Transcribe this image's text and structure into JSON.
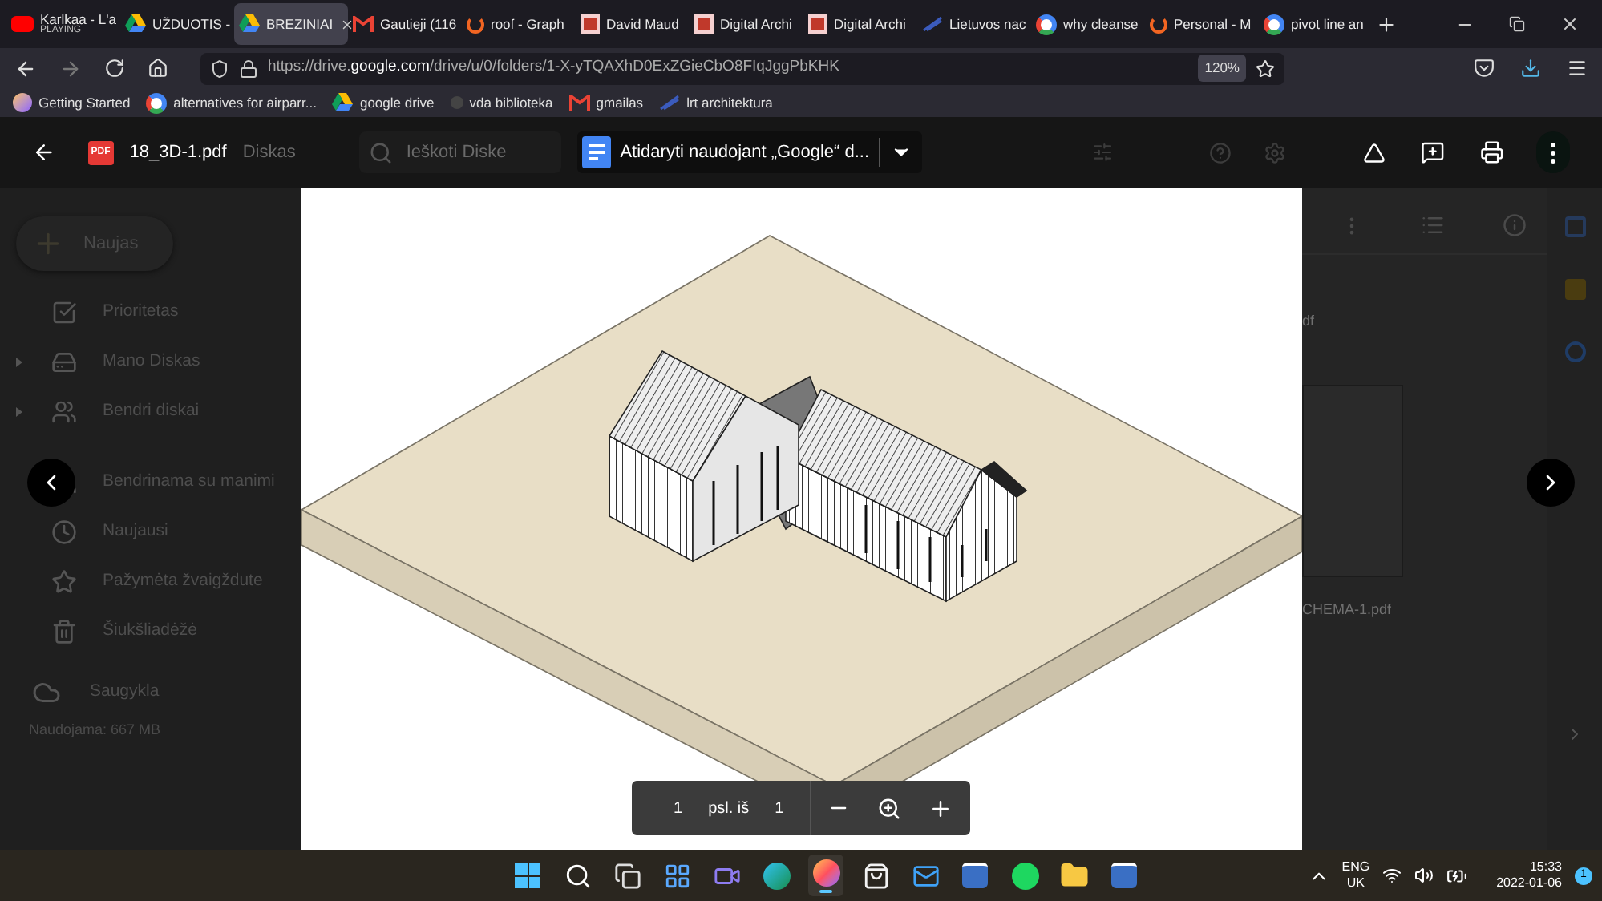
{
  "browser": {
    "tabs": [
      {
        "title": "Karlkaa - L'a",
        "subtitle": "PLAYING",
        "kind": "youtube",
        "selected": false
      },
      {
        "title": "UŽDUOTIS -",
        "kind": "drive",
        "selected": false
      },
      {
        "title": "BREZINIAI",
        "kind": "drive",
        "selected": true
      },
      {
        "title": "Gautieji (116",
        "kind": "gmail",
        "selected": false
      },
      {
        "title": "roof - Graph",
        "kind": "ring",
        "selected": false
      },
      {
        "title": "David Maud",
        "kind": "archive",
        "selected": false
      },
      {
        "title": "Digital Archi",
        "kind": "archive",
        "selected": false
      },
      {
        "title": "Digital Archi",
        "kind": "archive",
        "selected": false
      },
      {
        "title": "Lietuvos nac",
        "kind": "lnb",
        "selected": false
      },
      {
        "title": "why cleanse",
        "kind": "google",
        "selected": false
      },
      {
        "title": "Personal - M",
        "kind": "ring",
        "selected": false
      },
      {
        "title": "pivot line an",
        "kind": "google",
        "selected": false
      }
    ],
    "url": {
      "prefix": "https://drive.",
      "domain": "google.com",
      "path": "/drive/u/0/folders/1-X-yTQAXhD0ExZGieCbO8FIqJggPbKHK"
    },
    "zoom": "120%",
    "bookmarks": [
      {
        "label": "Getting Started",
        "kind": "firefox"
      },
      {
        "label": "alternatives for airparr...",
        "kind": "google"
      },
      {
        "label": "google drive",
        "kind": "drive"
      },
      {
        "label": "vda biblioteka",
        "kind": "star"
      },
      {
        "label": "gmailas",
        "kind": "gmail"
      },
      {
        "label": "lrt architektura",
        "kind": "lnb"
      }
    ]
  },
  "drive": {
    "logo_text": "Diskas",
    "search_placeholder": "Ieškoti Diske",
    "new_button": "Naujas",
    "nav": [
      {
        "label": "Prioritetas",
        "kind": "check",
        "expandable": false
      },
      {
        "label": "Mano Diskas",
        "kind": "drive",
        "expandable": true
      },
      {
        "label": "Bendri diskai",
        "kind": "shared",
        "expandable": true
      },
      {
        "label": "Bendrinama su manimi",
        "kind": "people",
        "expandable": false
      },
      {
        "label": "Naujausi",
        "kind": "clock",
        "expandable": false
      },
      {
        "label": "Pažymėta žvaigždute",
        "kind": "star",
        "expandable": false
      },
      {
        "label": "Šiukšliadėžė",
        "kind": "trash",
        "expandable": false
      }
    ],
    "storage": "Saugykla",
    "usage": "Naudojama: 667 MB",
    "files": [
      "df",
      "CHEMA-1.pdf"
    ]
  },
  "viewer": {
    "file_badge": "PDF",
    "file_name": "18_3D-1.pdf",
    "open_with": "Atidaryti naudojant „Google“ d...",
    "page_toolbar": {
      "page": "1",
      "of_label": "psl. iš",
      "total": "1"
    }
  },
  "taskbar": {
    "apps": [
      {
        "kind": "windows",
        "selected": false
      },
      {
        "kind": "search",
        "selected": false
      },
      {
        "kind": "taskview",
        "selected": false
      },
      {
        "kind": "widgets",
        "selected": false
      },
      {
        "kind": "chat",
        "selected": false
      },
      {
        "kind": "edge",
        "selected": false
      },
      {
        "kind": "firefox",
        "selected": true
      },
      {
        "kind": "store",
        "selected": false
      },
      {
        "kind": "mail",
        "selected": false
      },
      {
        "kind": "archicad",
        "selected": false
      },
      {
        "kind": "spotify",
        "selected": false
      },
      {
        "kind": "folder",
        "selected": false
      },
      {
        "kind": "archicad",
        "selected": false
      }
    ],
    "language": "ENG",
    "layout": "UK",
    "time": "15:33",
    "date": "2022-01-06",
    "notifications": "1"
  }
}
